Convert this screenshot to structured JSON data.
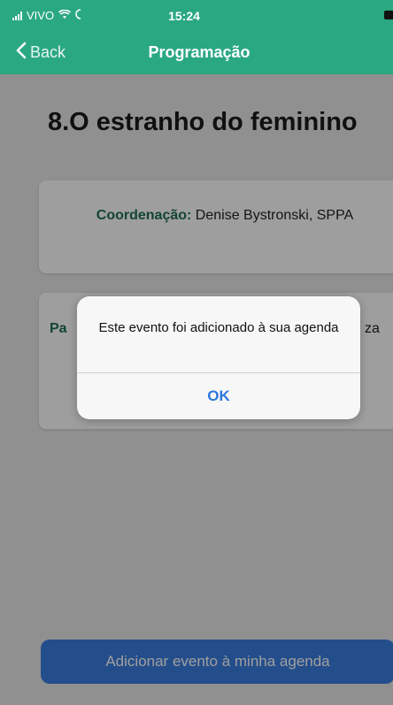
{
  "status_bar": {
    "carrier": "VIVO",
    "time": "15:24"
  },
  "nav": {
    "back_label": "Back",
    "title": "Programação"
  },
  "event": {
    "title": "8.O estranho do feminino",
    "coordination_label": "Coordenação:",
    "coordination_value": "Denise Bystronski, SPPA",
    "card2_left_fragment": "Pa",
    "card2_right_fragment": "za"
  },
  "actions": {
    "add_to_agenda": "Adicionar evento à minha agenda"
  },
  "alert": {
    "message": "Este evento foi adicionado à sua agenda",
    "ok_label": "OK"
  },
  "colors": {
    "header_green": "#2aa882",
    "alert_button_blue": "#2c78de",
    "primary_button_blue": "#3a7ee0"
  }
}
